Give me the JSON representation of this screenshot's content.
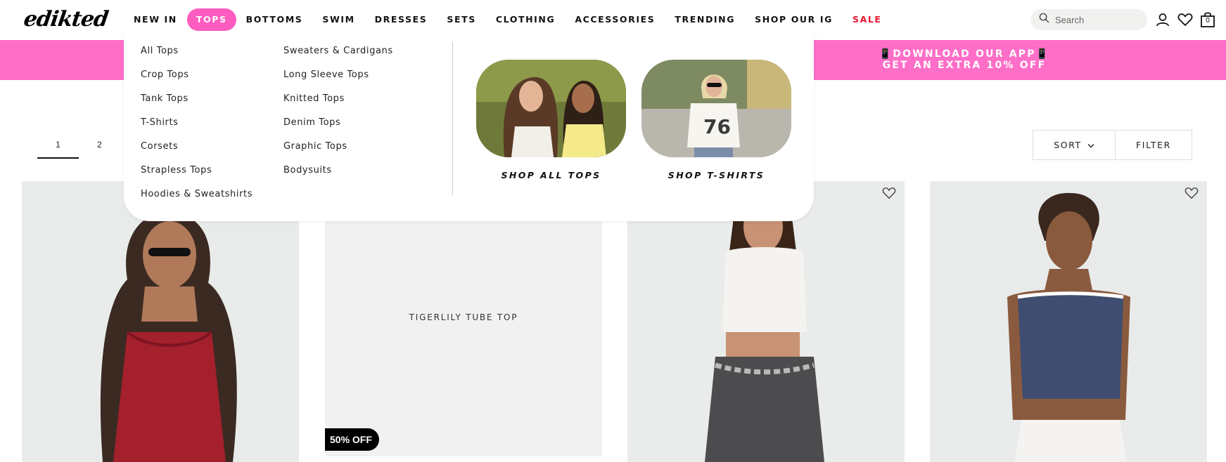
{
  "brand": {
    "logo_text": "edikted"
  },
  "nav": {
    "items": [
      {
        "label": "NEW IN"
      },
      {
        "label": "TOPS"
      },
      {
        "label": "BOTTOMS"
      },
      {
        "label": "SWIM"
      },
      {
        "label": "DRESSES"
      },
      {
        "label": "SETS"
      },
      {
        "label": "CLOTHING"
      },
      {
        "label": "ACCESSORIES"
      },
      {
        "label": "TRENDING"
      },
      {
        "label": "SHOP OUR IG"
      },
      {
        "label": "SALE"
      }
    ],
    "active_item": "TOPS"
  },
  "header": {
    "search_placeholder": "Search",
    "cart_count": "0",
    "icons": [
      "search-icon",
      "account-icon",
      "wishlist-heart-icon",
      "cart-bag-icon"
    ]
  },
  "banner": {
    "line1": "📱DOWNLOAD OUR APP📱",
    "line2": "GET AN EXTRA 10% OFF",
    "color": "#ff6ec7"
  },
  "mega_menu": {
    "col1": [
      "All Tops",
      "Crop Tops",
      "Tank Tops",
      "T-Shirts",
      "Corsets",
      "Strapless Tops",
      "Hoodies & Sweatshirts"
    ],
    "col2": [
      "Sweaters & Cardigans",
      "Long Sleeve Tops",
      "Knitted Tops",
      "Denim Tops",
      "Graphic Tops",
      "Bodysuits"
    ],
    "promos": [
      {
        "label": "SHOP ALL TOPS"
      },
      {
        "label": "SHOP T-SHIRTS"
      }
    ]
  },
  "pagination": {
    "pages": [
      "1",
      "2"
    ],
    "current": "1"
  },
  "controls": {
    "sort_label": "SORT",
    "filter_label": "FILTER"
  },
  "products": [
    {
      "name": ""
    },
    {
      "name": "TIGERLILY TUBE TOP",
      "badge": "50% OFF"
    },
    {
      "name": ""
    },
    {
      "name": ""
    }
  ],
  "colors": {
    "accent_pink": "#ff5cc0",
    "sale_red": "#e8162c"
  }
}
